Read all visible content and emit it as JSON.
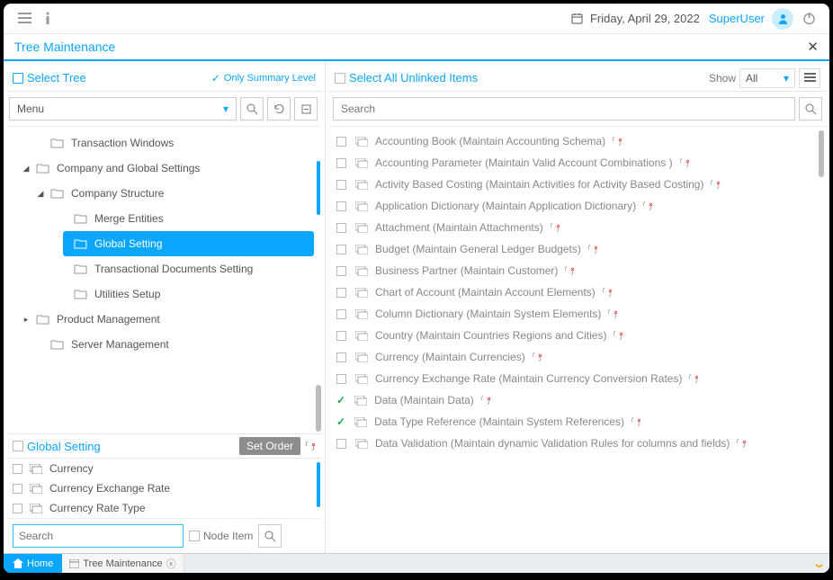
{
  "header": {
    "date": "Friday, April 29, 2022",
    "user": "SuperUser"
  },
  "page": {
    "title": "Tree Maintenance"
  },
  "left": {
    "pane_title": "Select Tree",
    "summary_only": "Only Summary Level",
    "tree_selector": "Menu",
    "nodes": [
      {
        "label": "Transaction Windows",
        "level": 1,
        "expandable": false
      },
      {
        "label": "Company and Global Settings",
        "level": 0,
        "expandable": true,
        "expanded": true
      },
      {
        "label": "Company Structure",
        "level": 2,
        "expandable": true,
        "expanded": true,
        "hasArrow": true
      },
      {
        "label": "Merge Entities",
        "level": 3
      },
      {
        "label": "Global Setting",
        "level": 3,
        "active": true
      },
      {
        "label": "Transactional Documents Setting",
        "level": 3
      },
      {
        "label": "Utilities Setup",
        "level": 3
      },
      {
        "label": "Product Management",
        "level": 1,
        "expandable": true
      },
      {
        "label": "Server Management",
        "level": 1
      }
    ],
    "detail": {
      "title": "Global Setting",
      "set_order": "Set Order",
      "rows": [
        "Currency",
        "Currency Exchange Rate",
        "Currency Rate Type"
      ]
    },
    "search_placeholder": "Search",
    "node_item_label": "Node Item"
  },
  "right": {
    "pane_title": "Select All Unlinked Items",
    "show_label": "Show",
    "show_value": "All",
    "search_placeholder": "Search",
    "items": [
      {
        "label": "Accounting Book (Maintain Accounting Schema)"
      },
      {
        "label": "Accounting Parameter (Maintain Valid Account Combinations )"
      },
      {
        "label": "Activity Based Costing (Maintain Activities for Activity Based Costing)"
      },
      {
        "label": "Application Dictionary (Maintain Application Dictionary)"
      },
      {
        "label": "Attachment (Maintain Attachments)"
      },
      {
        "label": "Budget (Maintain General Ledger Budgets)"
      },
      {
        "label": "Business Partner (Maintain Customer)"
      },
      {
        "label": "Chart of Account (Maintain Account Elements)"
      },
      {
        "label": "Column Dictionary (Maintain System Elements)"
      },
      {
        "label": "Country (Maintain Countries Regions and Cities)"
      },
      {
        "label": "Currency (Maintain Currencies)"
      },
      {
        "label": "Currency Exchange Rate (Maintain Currency Conversion Rates)"
      },
      {
        "label": "Data (Maintain Data)",
        "checked": true
      },
      {
        "label": "Data Type Reference (Maintain System References)",
        "checked": true
      },
      {
        "label": "Data Validation (Maintain dynamic Validation Rules for columns and fields)"
      }
    ]
  },
  "tabs": {
    "home": "Home",
    "tree_maint": "Tree Maintenance"
  }
}
